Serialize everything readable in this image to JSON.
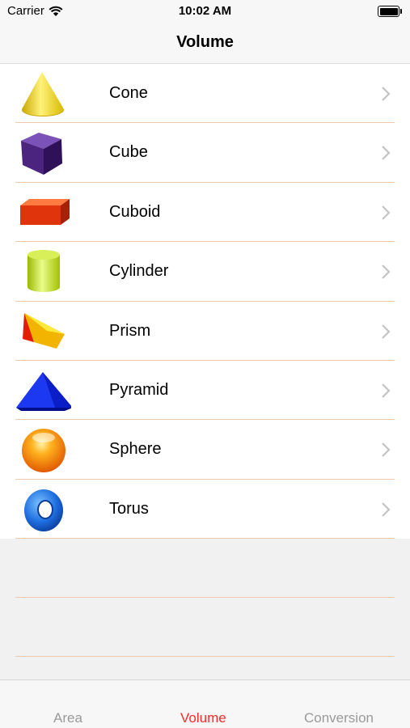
{
  "status_bar": {
    "carrier": "Carrier",
    "time": "10:02 AM"
  },
  "nav": {
    "title": "Volume"
  },
  "shapes": [
    {
      "label": "Cone",
      "icon": "cone-icon"
    },
    {
      "label": "Cube",
      "icon": "cube-icon"
    },
    {
      "label": "Cuboid",
      "icon": "cuboid-icon"
    },
    {
      "label": "Cylinder",
      "icon": "cylinder-icon"
    },
    {
      "label": "Prism",
      "icon": "prism-icon"
    },
    {
      "label": "Pyramid",
      "icon": "pyramid-icon"
    },
    {
      "label": "Sphere",
      "icon": "sphere-icon"
    },
    {
      "label": "Torus",
      "icon": "torus-icon"
    }
  ],
  "tab_bar": {
    "tabs": [
      {
        "label": "Area",
        "active": false
      },
      {
        "label": "Volume",
        "active": true
      },
      {
        "label": "Conversion",
        "active": false
      }
    ]
  },
  "colors": {
    "accent": "#ff2a2a",
    "separator": "#f0c9ad",
    "inactive_tab": "#9a9a9a"
  }
}
